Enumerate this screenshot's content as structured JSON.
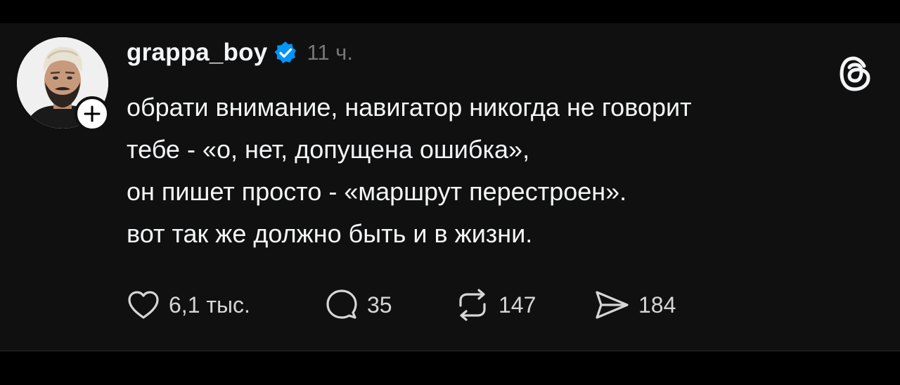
{
  "post": {
    "username": "grappa_boy",
    "time": "11 ч.",
    "verified": true,
    "lines": [
      "обрати внимание, навигатор никогда не говорит",
      "тебе - «о, нет, допущена ошибка»,",
      "он пишет просто - «маршрут перестроен».",
      "вот так же должно быть и в жизни."
    ],
    "actions": {
      "likes": "6,1 тыс.",
      "replies": "35",
      "reposts": "147",
      "shares": "184"
    }
  },
  "icons": {
    "follow": "plus-icon",
    "verified": "verified-badge-icon",
    "brand": "threads-logo-icon",
    "like": "heart-icon",
    "reply": "comment-icon",
    "repost": "repost-icon",
    "share": "send-icon"
  },
  "colors": {
    "background": "#101010",
    "text": "#f3f5f7",
    "muted": "#777777",
    "verified": "#0095f6"
  }
}
